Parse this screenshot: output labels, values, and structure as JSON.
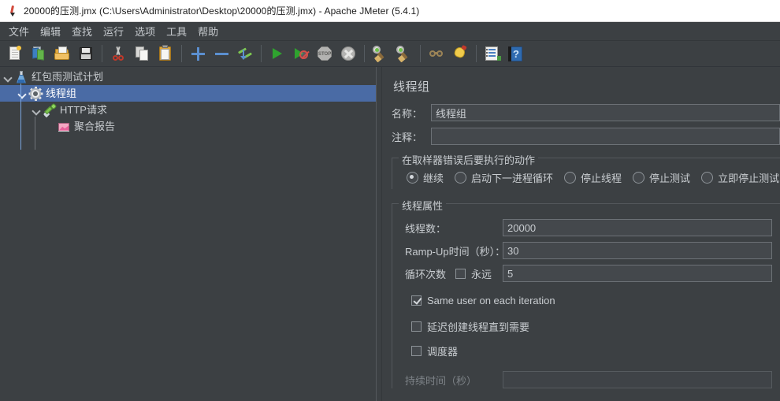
{
  "window": {
    "title": "20000的压测.jmx (C:\\Users\\Administrator\\Desktop\\20000的压测.jmx) - Apache JMeter (5.4.1)",
    "icon": "jmeter-pen-icon"
  },
  "menubar": {
    "items": [
      {
        "label": "文件",
        "name": "menu-file"
      },
      {
        "label": "编辑",
        "name": "menu-edit"
      },
      {
        "label": "查找",
        "name": "menu-search"
      },
      {
        "label": "运行",
        "name": "menu-run"
      },
      {
        "label": "选项",
        "name": "menu-options"
      },
      {
        "label": "工具",
        "name": "menu-tools"
      },
      {
        "label": "帮助",
        "name": "menu-help"
      }
    ]
  },
  "toolbar": {
    "buttons": [
      {
        "name": "new-test-plan-button",
        "icon": "new-document-icon"
      },
      {
        "name": "templates-button",
        "icon": "templates-icon"
      },
      {
        "name": "open-button",
        "icon": "open-folder-icon"
      },
      {
        "name": "save-button",
        "icon": "floppy-save-icon"
      },
      {
        "name": "cut-button",
        "icon": "scissors-icon"
      },
      {
        "name": "copy-button",
        "icon": "copy-icon"
      },
      {
        "name": "paste-button",
        "icon": "clipboard-paste-icon"
      },
      {
        "name": "expand-all-button",
        "icon": "plus-icon"
      },
      {
        "name": "collapse-all-button",
        "icon": "minus-icon"
      },
      {
        "name": "toggle-button",
        "icon": "toggle-pencils-icon"
      },
      {
        "name": "start-button",
        "icon": "play-green-icon"
      },
      {
        "name": "start-no-pauses-button",
        "icon": "play-no-pauses-icon"
      },
      {
        "name": "stop-button",
        "icon": "stop-sign-icon"
      },
      {
        "name": "shutdown-button",
        "icon": "shutdown-x-icon"
      },
      {
        "name": "clear-button",
        "icon": "clear-broom-icon"
      },
      {
        "name": "clear-all-button",
        "icon": "clear-all-broom-icon"
      },
      {
        "name": "search-button",
        "icon": "binoculars-icon"
      },
      {
        "name": "reset-search-button",
        "icon": "clear-search-bell-icon"
      },
      {
        "name": "function-helper-button",
        "icon": "function-helper-icon"
      },
      {
        "name": "help-button",
        "icon": "help-question-icon"
      }
    ]
  },
  "tree": {
    "nodes": [
      {
        "label": "红包雨测试计划",
        "icon": "test-plan-flask-icon",
        "depth": 0,
        "expanded": true,
        "selected": false,
        "name": "tree-node-test-plan"
      },
      {
        "label": "线程组",
        "icon": "thread-group-gear-icon",
        "depth": 1,
        "expanded": true,
        "selected": true,
        "name": "tree-node-thread-group"
      },
      {
        "label": "HTTP请求",
        "icon": "http-request-dropper-icon",
        "depth": 2,
        "expanded": true,
        "selected": false,
        "name": "tree-node-http-request"
      },
      {
        "label": "聚合报告",
        "icon": "aggregate-report-chart-icon",
        "depth": 3,
        "expanded": false,
        "selected": false,
        "name": "tree-node-aggregate-report"
      }
    ]
  },
  "config": {
    "panel_title": "线程组",
    "name_label": "名称：",
    "name_value": "线程组",
    "comment_label": "注释：",
    "comment_value": "",
    "error_action": {
      "group_title": "在取样器错误后要执行的动作",
      "options": [
        {
          "label": "继续",
          "selected": true,
          "name": "radio-continue"
        },
        {
          "label": "启动下一进程循环",
          "selected": false,
          "name": "radio-start-next-loop"
        },
        {
          "label": "停止线程",
          "selected": false,
          "name": "radio-stop-thread"
        },
        {
          "label": "停止测试",
          "selected": false,
          "name": "radio-stop-test"
        },
        {
          "label": "立即停止测试",
          "selected": false,
          "name": "radio-stop-test-now"
        }
      ]
    },
    "thread_properties": {
      "group_title": "线程属性",
      "num_threads_label": "线程数：",
      "num_threads_value": "20000",
      "ramp_up_label": "Ramp-Up时间（秒）：",
      "ramp_up_value": "30",
      "loop_count_label": "循环次数",
      "loop_forever_label": "永远",
      "loop_forever_checked": false,
      "loop_count_value": "5",
      "same_user_label": "Same user on each iteration",
      "same_user_checked": true,
      "delayed_start_label": "延迟创建线程直到需要",
      "delayed_start_checked": false,
      "scheduler_label": "调度器",
      "scheduler_checked": false,
      "duration_label": "持续时间（秒）",
      "duration_value": "",
      "duration_disabled": true
    }
  },
  "colors": {
    "background": "#3c4043",
    "selection": "#4a6ba5",
    "text": "#c9cdd1",
    "text_disabled": "#7d8287",
    "border": "#6c7176",
    "titlebar_bg": "#ffffff"
  }
}
